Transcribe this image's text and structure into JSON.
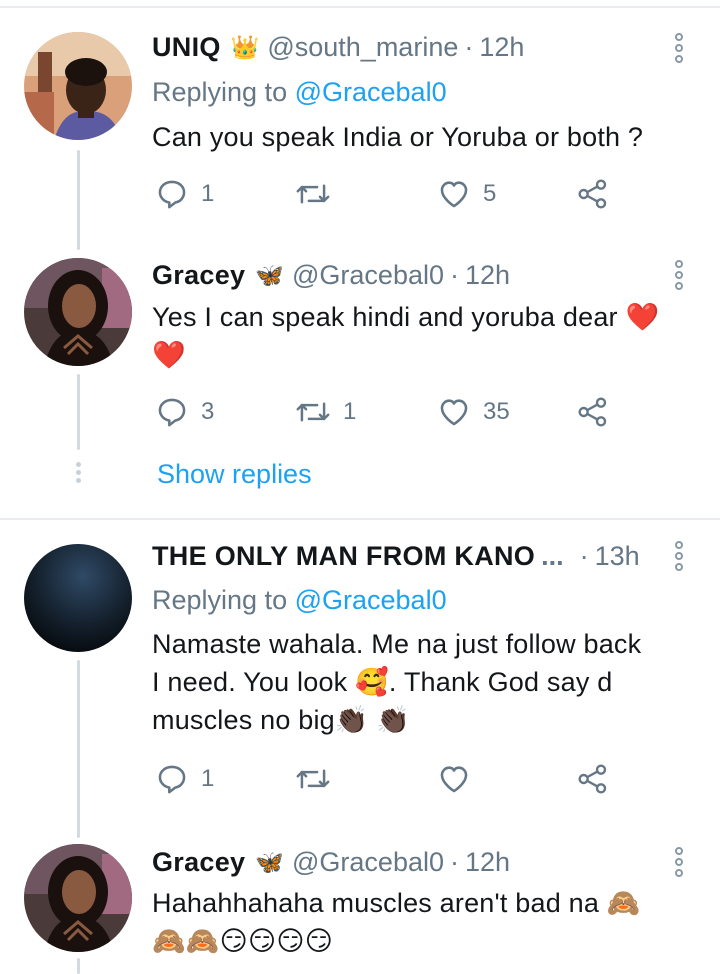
{
  "replies": [
    {
      "name": "UNIQ",
      "badge": "👑",
      "handle": "@south_marine",
      "separator": "·",
      "time": "12h",
      "replying_prefix": "Replying to",
      "replying_to": "@Gracebal0",
      "text": "Can you speak India or Yoruba or both ?",
      "reply_count": "1",
      "retweet_count": "",
      "like_count": "5"
    },
    {
      "name": "Gracey",
      "badge": "🦋",
      "handle": "@Gracebal0",
      "separator": "·",
      "time": "12h",
      "text_line1": "Yes I can speak hindi and yoruba dear",
      "emoji_heart": "❤️",
      "reply_count": "3",
      "retweet_count": "1",
      "like_count": "35"
    },
    {
      "name": "THE ONLY MAN FROM KANO",
      "ellipsis": "...",
      "separator": "·",
      "time": "13h",
      "replying_prefix": "Replying to",
      "replying_to": "@Gracebal0",
      "text_line1": "Namaste wahala. Me na just follow back",
      "text_line2a": "I need. You look",
      "emoji_love": "🥰",
      "text_line2b": ". Thank God say d",
      "text_line3": "muscles no big",
      "emoji_clap": "👏🏿",
      "reply_count": "1",
      "retweet_count": "",
      "like_count": ""
    },
    {
      "name": "Gracey",
      "badge": "🦋",
      "handle": "@Gracebal0",
      "separator": "·",
      "time": "12h",
      "text_line1": "Hahahhahaha muscles aren't bad na",
      "emoji_monkey": "🙈",
      "emoji_smirk": "😏"
    }
  ],
  "show_replies_label": "Show replies",
  "colors": {
    "link": "#1da1f2",
    "secondary_text": "#657786",
    "thread_line": "#d3dbe2",
    "separator": "#e6ecf0"
  },
  "icons": [
    "reply-icon",
    "retweet-icon",
    "like-icon",
    "share-icon",
    "more-options-icon"
  ]
}
